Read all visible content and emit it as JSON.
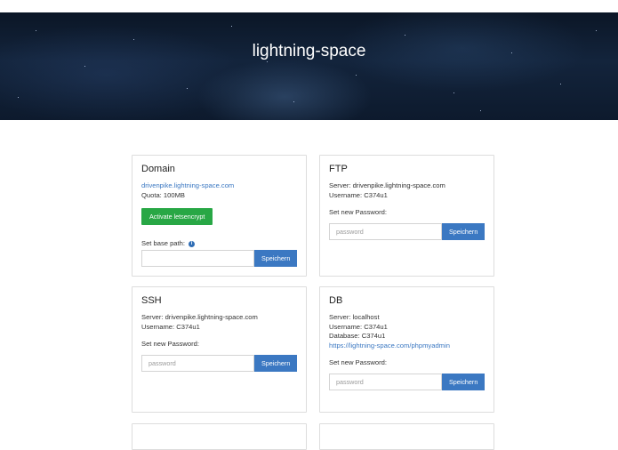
{
  "banner": {
    "title": "lightning-space"
  },
  "domain": {
    "title": "Domain",
    "url": "drivenpike.lightning-space.com",
    "quota": "Quota: 100MB",
    "letsencrypt_label": "Activate letsencrypt",
    "base_path_label": "Set base path:",
    "base_path_value": "",
    "save_label": "Speichern"
  },
  "ftp": {
    "title": "FTP",
    "server": "Server: drivenpike.lightning-space.com",
    "username": "Username: C374u1",
    "password_label": "Set new Password:",
    "password_placeholder": "password",
    "save_label": "Speichern"
  },
  "ssh": {
    "title": "SSH",
    "server": "Server: drivenpike.lightning-space.com",
    "username": "Username: C374u1",
    "password_label": "Set new Password:",
    "password_placeholder": "password",
    "save_label": "Speichern"
  },
  "db": {
    "title": "DB",
    "server": "Server: localhost",
    "username": "Username: C374u1",
    "database": "Database: C374u1",
    "phpmyadmin": "https://lightning-space.com/phpmyadmin",
    "password_label": "Set new Password:",
    "password_placeholder": "password",
    "save_label": "Speichern"
  },
  "colors": {
    "primary": "#3b78c2",
    "success": "#28a745",
    "link": "#3b78c2"
  },
  "icons": {
    "info": "info-circle-icon"
  }
}
